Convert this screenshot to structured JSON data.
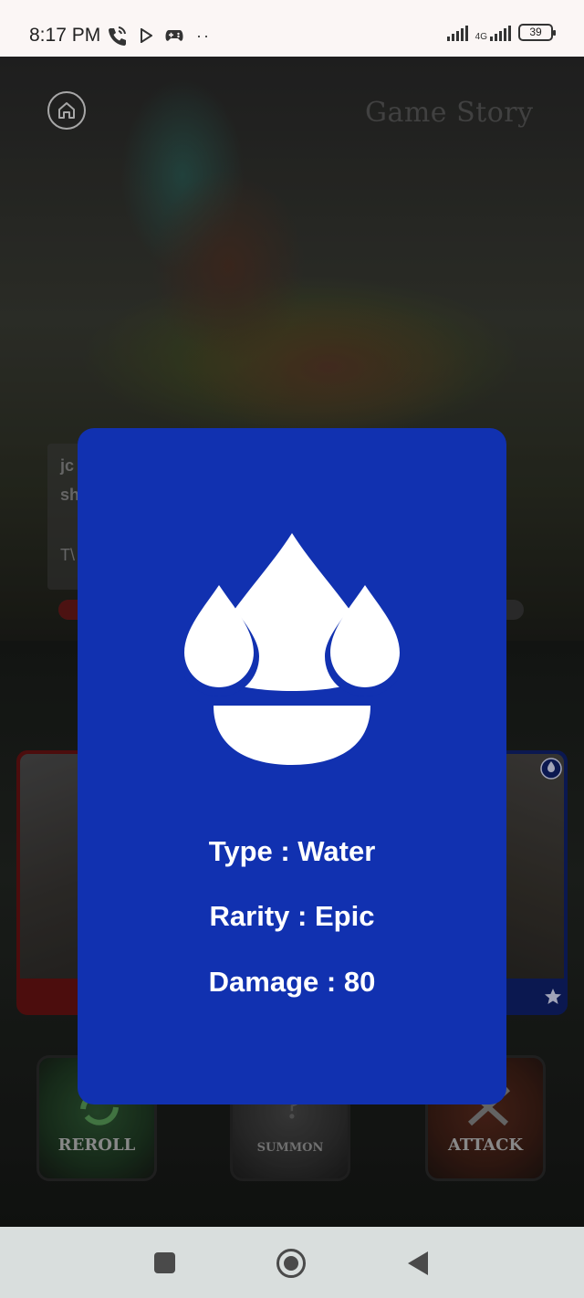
{
  "status_bar": {
    "time": "8:17 PM",
    "network_type": "4G",
    "battery": "39",
    "icons": [
      "wifi-call-icon",
      "play-icon",
      "gamepad-icon",
      "more-dots-icon",
      "signal-icon",
      "signal-4g-icon",
      "battery-icon"
    ]
  },
  "header": {
    "title": "Game Story",
    "home_icon": "home-icon"
  },
  "background_story": {
    "line1": "jc",
    "line2": "sh",
    "line3": "T\\"
  },
  "actions": {
    "reroll": "REROLL",
    "summon": "SUMMON",
    "attack": "ATTACK"
  },
  "element_card": {
    "icon": "water-drops-icon",
    "type_text": "Type : Water",
    "rarity_text": "Rarity : Epic",
    "damage_text": "Damage : 80",
    "background_color": "#1131b0"
  },
  "nav_bar": {
    "recents_icon": "square-icon",
    "home_icon": "circle-home-icon",
    "back_icon": "back-triangle-icon"
  }
}
